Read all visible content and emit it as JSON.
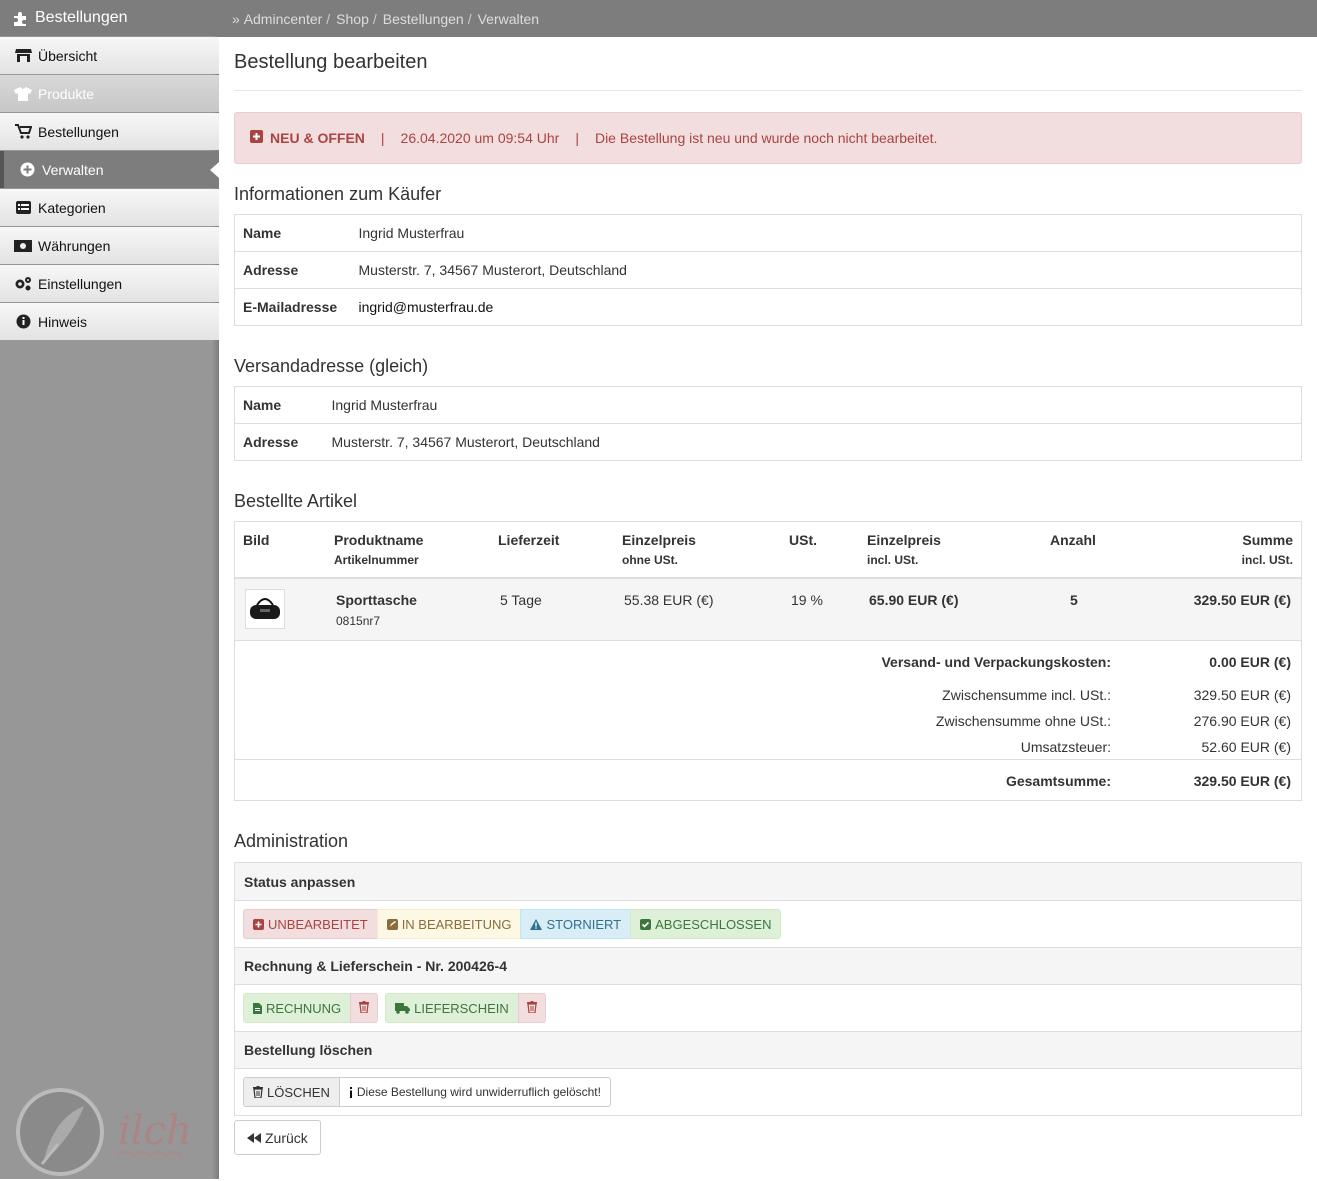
{
  "sidebar": {
    "title": "Bestellungen",
    "items": [
      {
        "label": "Übersicht",
        "icon": "store-icon"
      },
      {
        "label": "Produkte",
        "icon": "shirt-icon"
      },
      {
        "label": "Bestellungen",
        "icon": "cart-icon"
      },
      {
        "label": "Verwalten",
        "icon": "plus-circle-icon"
      },
      {
        "label": "Kategorien",
        "icon": "list-icon"
      },
      {
        "label": "Währungen",
        "icon": "money-icon"
      },
      {
        "label": "Einstellungen",
        "icon": "gears-icon"
      },
      {
        "label": "Hinweis",
        "icon": "info-circle-icon"
      }
    ],
    "logo_text": "ilch"
  },
  "breadcrumb": {
    "prefix": "»",
    "items": [
      "Admincenter",
      "Shop",
      "Bestellungen",
      "Verwalten"
    ],
    "sep": "/"
  },
  "page": {
    "title": "Bestellung bearbeiten"
  },
  "alert": {
    "status": "NEU & OFFEN",
    "date": "26.04.2020 um 09:54 Uhr",
    "message": "Die Bestellung ist neu und wurde noch nicht bearbeitet.",
    "sep": "|"
  },
  "buyer": {
    "heading": "Informationen zum Käufer",
    "rows": [
      {
        "label": "Name",
        "value": "Ingrid Musterfrau"
      },
      {
        "label": "Adresse",
        "value": "Musterstr. 7, 34567 Musterort, Deutschland"
      },
      {
        "label": "E-Mailadresse",
        "value": "ingrid@musterfrau.de"
      }
    ]
  },
  "shipping": {
    "heading": "Versandadresse (gleich)",
    "rows": [
      {
        "label": "Name",
        "value": "Ingrid Musterfrau"
      },
      {
        "label": "Adresse",
        "value": "Musterstr. 7, 34567 Musterort, Deutschland"
      }
    ]
  },
  "items": {
    "heading": "Bestellte Artikel",
    "columns": {
      "bild": "Bild",
      "produktname": "Produktname",
      "artikelnummer": "Artikelnummer",
      "lieferzeit": "Lieferzeit",
      "einzelpreis": "Einzelpreis",
      "ohne_ust": "ohne USt.",
      "ust": "USt.",
      "einzelpreis_incl": "Einzelpreis",
      "incl_ust": "incl. USt.",
      "anzahl": "Anzahl",
      "summe": "Summe",
      "summe_sub": "incl. USt."
    },
    "row": {
      "name": "Sporttasche",
      "sku": "0815nr7",
      "delivery": "5 Tage",
      "price_net": "55.38 EUR (€)",
      "tax": "19 %",
      "price_gross": "65.90 EUR (€)",
      "qty": "5",
      "sum": "329.50 EUR (€)"
    },
    "summary": {
      "shipping_label": "Versand- und Verpackungskosten:",
      "shipping_value": "0.00 EUR (€)",
      "subtotal_gross_label": "Zwischensumme incl. USt.:",
      "subtotal_gross_value": "329.50 EUR (€)",
      "subtotal_net_label": "Zwischensumme ohne USt.:",
      "subtotal_net_value": "276.90 EUR (€)",
      "tax_label": "Umsatzsteuer:",
      "tax_value": "52.60 EUR (€)",
      "total_label": "Gesamtsumme:",
      "total_value": "329.50 EUR (€)"
    }
  },
  "admin": {
    "heading": "Administration",
    "status_heading": "Status anpassen",
    "status_buttons": [
      "UNBEARBEITET",
      "IN BEARBEITUNG",
      "STORNIERT",
      "ABGESCHLOSSEN"
    ],
    "invoice_heading": "Rechnung & Lieferschein - Nr. 200426-4",
    "invoice_button": "RECHNUNG",
    "delivery_button": "LIEFERSCHEIN",
    "delete_heading": "Bestellung löschen",
    "delete_button": "LÖSCHEN",
    "delete_note": "Diese Bestellung wird unwiderruflich gelöscht!"
  },
  "back_button": "Zurück",
  "colors": {
    "danger": "#a94442",
    "success": "#3c763d",
    "info": "#31708f",
    "warning": "#8a6d3b"
  }
}
